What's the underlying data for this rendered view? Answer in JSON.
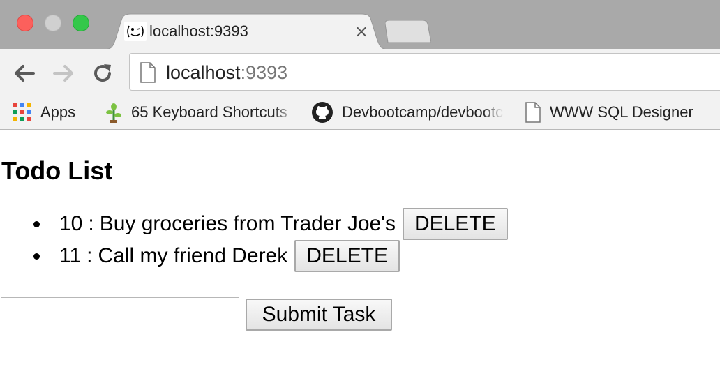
{
  "browser": {
    "tab": {
      "title": "localhost:9393",
      "close_glyph": "×",
      "favicon": "smiley-favicon-icon"
    },
    "toolbar": {
      "back_icon": "back-arrow-icon",
      "forward_icon": "forward-arrow-icon",
      "reload_icon": "reload-icon"
    },
    "address_bar": {
      "host": "localhost",
      "port": ":9393"
    },
    "bookmarks": [
      {
        "label": "Apps",
        "icon": "apps-grid-icon"
      },
      {
        "label": "65 Keyboard Shortcuts",
        "icon": "plant-icon"
      },
      {
        "label": "Devbootcamp/devbootcamp",
        "icon": "github-icon"
      },
      {
        "label": "WWW SQL Designer",
        "icon": "page-icon"
      }
    ]
  },
  "page": {
    "title": "Todo List",
    "todos": [
      {
        "id": "10",
        "separator": ":",
        "text": "Buy groceries from Trader Joe's",
        "delete_label": "DELETE"
      },
      {
        "id": "11",
        "separator": ":",
        "text": "Call my friend Derek",
        "delete_label": "DELETE"
      }
    ],
    "form": {
      "input_value": "",
      "submit_label": "Submit Task"
    }
  }
}
